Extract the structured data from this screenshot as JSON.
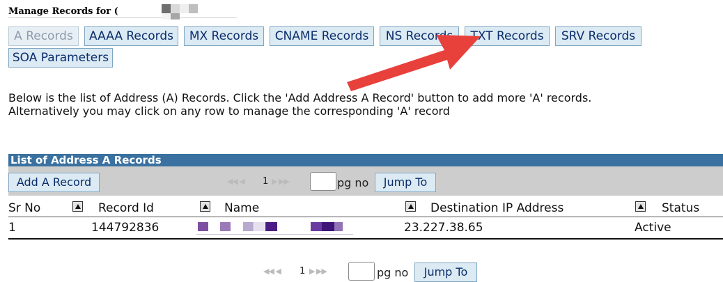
{
  "title": "Manage Records for (",
  "tabs": [
    {
      "label": "A Records",
      "disabled": true
    },
    {
      "label": "AAAA Records"
    },
    {
      "label": "MX Records"
    },
    {
      "label": "CNAME Records"
    },
    {
      "label": "NS Records"
    },
    {
      "label": "TXT Records"
    },
    {
      "label": "SRV Records"
    },
    {
      "label": "SOA Parameters"
    }
  ],
  "intro": {
    "line1": "Below is the list of Address (A) Records. Click the 'Add Address A Record' button to add more 'A' records.",
    "line2": "Alternatively you may click on any row to manage the corresponding 'A' record"
  },
  "list": {
    "header": "List of Address A Records",
    "add_button": "Add A Record",
    "pager": {
      "nav_back": "◀◀ ◀",
      "page": "1",
      "nav_fwd": "▶ ▶▶",
      "pg_label": "pg no",
      "jump_label": "Jump To"
    },
    "columns": {
      "sr_no": "Sr No",
      "record_id": "Record Id",
      "name": "Name",
      "dest_ip": "Destination IP Address",
      "status": "Status"
    },
    "rows": [
      {
        "sr_no": "1",
        "record_id": "144792836",
        "name": "",
        "dest_ip": "23.227.38.65",
        "status": "Active"
      }
    ]
  },
  "bottom_pager": {
    "nav_back": "◀◀ ◀",
    "page": "1",
    "nav_fwd": "▶ ▶▶",
    "pg_label": "pg no",
    "jump_label": "Jump To"
  },
  "icons": [
    "sort-up-icon",
    "redacted-name-block",
    "annotation-arrow-icon"
  ],
  "colors": {
    "tab_bg": "#dbeaf3",
    "tab_text": "#0b2d6b",
    "list_header_bg": "#3a71a0",
    "toolbar_bg": "#cdcdcd",
    "arrow": "#e8413c"
  }
}
